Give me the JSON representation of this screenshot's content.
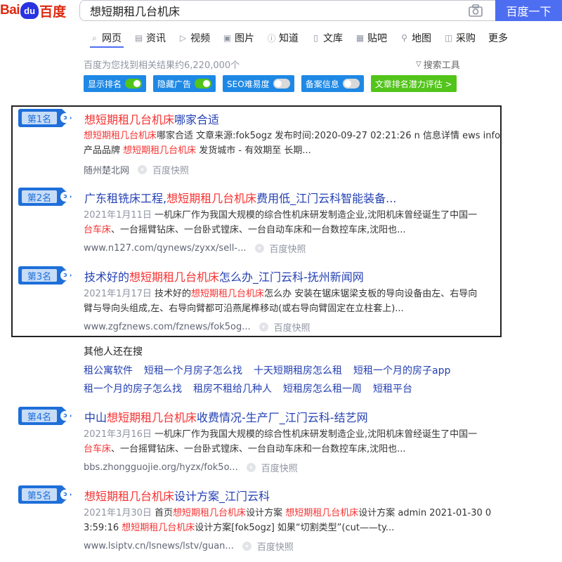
{
  "logo": {
    "bai": "Bai",
    "paw": "du",
    "cn": "百度"
  },
  "search": {
    "query": "想短期租几台机床",
    "button_label": "百度一下"
  },
  "tabs": [
    {
      "label": "网页",
      "icon": "search-icon"
    },
    {
      "label": "资讯",
      "icon": "news-icon"
    },
    {
      "label": "视频",
      "icon": "video-icon"
    },
    {
      "label": "图片",
      "icon": "image-icon"
    },
    {
      "label": "知道",
      "icon": "question-icon"
    },
    {
      "label": "文库",
      "icon": "doc-icon"
    },
    {
      "label": "贴吧",
      "icon": "tieba-icon"
    },
    {
      "label": "地图",
      "icon": "map-pin-icon"
    },
    {
      "label": "采购",
      "icon": "cart-icon"
    },
    {
      "label": "更多",
      "icon": ""
    }
  ],
  "result_count": "百度为您找到相关结果约6,220,000个",
  "search_tools": "搜索工具",
  "chips": [
    {
      "label": "显示排名",
      "toggle": "on"
    },
    {
      "label": "隐藏广告",
      "toggle": "on"
    },
    {
      "label": "SEO难易度",
      "toggle": "off"
    },
    {
      "label": "备案信息",
      "toggle": "off"
    },
    {
      "label": "文章排名潜力评估 >"
    }
  ],
  "results": [
    {
      "rank": "第1名",
      "title_hl": "想短期租几台机床",
      "title_rest": "哪家合适",
      "l1_hl": "想短期租几台机床",
      "l1_rest": "哪家合适 文章来源:fok5ogz 发布时间:2020-09-27 02:21:26 n 信息详情 ews info",
      "l2_pre": "产品品牌 ",
      "l2_hl": "想短期租几台机床",
      "l2_rest": " 发货城市 - 有效期至 长期...",
      "source": "随州楚北网",
      "snapshot": "百度快照"
    },
    {
      "rank": "第2名",
      "title_pre": "广东租铣床工程,",
      "title_hl": "想短期租几台机床",
      "title_rest": "费用低_江门云科智能装备...",
      "date": "2021年1月11日",
      "l1_rest": " 一机床厂作为我国大规模的综合性机床研发制造企业,沈阳机床曾经诞生了中国一",
      "l2_hl": "台车床",
      "l2_rest": "、一台摇臂钻床、一台卧式镗床、一台自动车床和一台数控车床,沈阳也...",
      "source": "www.n127.com/qynews/zyxx/sell-...",
      "snapshot": "百度快照"
    },
    {
      "rank": "第3名",
      "title_pre": "技术好的",
      "title_hl": "想短期租几台机床",
      "title_rest": "怎么办_江门云科-抚州新闻网",
      "date": "2021年1月17日",
      "l1_pre": " 技术好的",
      "l1_hl": "想短期租几台机床",
      "l1_rest": "怎么办 安装在锯床锯梁支板的导向设备由左、右导向",
      "l2_rest": "臂与导向头组成,左、右导向臂都可沿燕尾榫移动(或右导向臂固定在立柱套上)...",
      "source": "www.zgfznews.com/fznews/fok5og...",
      "snapshot": "百度快照"
    },
    {
      "rank": "第4名",
      "title_pre": "中山",
      "title_hl": "想短期租几台机床",
      "title_rest": "收费情况-生产厂_江门云科-结艺网",
      "date": "2021年3月16日",
      "l1_rest": " 一机床厂作为我国大规模的综合性机床研发制造企业,沈阳机床曾经诞生了中国一",
      "l2_hl": "台车床",
      "l2_rest": "、一台摇臂钻床、一台卧式镗床、一台自动车床和一台数控车床,沈阳也...",
      "source": "bbs.zhongguojie.org/hyzx/fok5o...",
      "snapshot": "百度快照"
    },
    {
      "rank": "第5名",
      "title_hl": "想短期租几台机床",
      "title_rest": "设计方案_江门云科",
      "date": "2021年1月30日",
      "l1_pre": " 首页",
      "l1_hl": "想短期租几台机床",
      "l1_mid": "设计方案 ",
      "l1_hl2": "想短期租几台机床",
      "l1_rest": "设计方案 admin 2021-01-30 0",
      "l2_pre": "3:59:16 ",
      "l2_hl": "想短期租几台机床",
      "l2_rest": "设计方案[fok5ogz] 如果“切割类型”(cut——ty...",
      "source": "www.lsiptv.cn/lsnews/lstv/guan...",
      "snapshot": "百度快照"
    }
  ],
  "related": {
    "title": "其他人还在搜",
    "row1": [
      "租公寓软件",
      "短租一个月房子怎么找",
      "十天短期租房怎么租",
      "短租一个月的房子app"
    ],
    "row2": [
      "租一个月的房子怎么找",
      "租房不租给几种人",
      "短租房怎么租一周",
      "短租平台"
    ]
  },
  "colors": {
    "accent": "#4e6ef2",
    "link": "#2440b3",
    "highlight": "#f73131",
    "badge": "#1e6fd9"
  }
}
